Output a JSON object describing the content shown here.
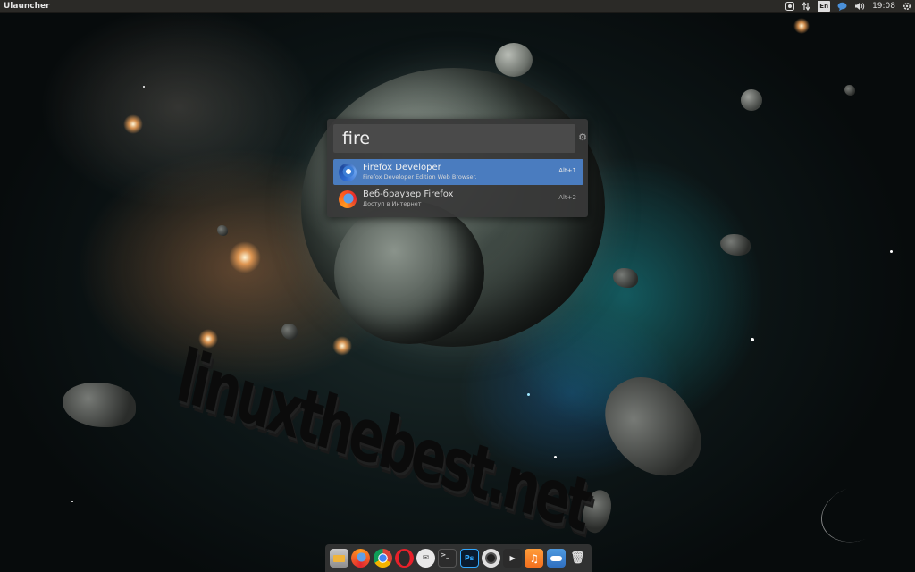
{
  "panel": {
    "title": "Ulauncher",
    "tray": {
      "lang": "En",
      "time": "19:08"
    }
  },
  "launcher": {
    "query": "fire",
    "results": [
      {
        "name": "Firefox Developer",
        "description": "Firefox Developer Edition Web Browser.",
        "shortcut": "Alt+1",
        "selected": true,
        "icon": "firefox-developer-icon"
      },
      {
        "name": "Веб-браузер Firefox",
        "description": "Доступ в Интернет",
        "shortcut": "Alt+2",
        "selected": false,
        "icon": "firefox-icon"
      }
    ]
  },
  "dock": {
    "items": [
      {
        "app": "files",
        "icon": "files-icon"
      },
      {
        "app": "firefox",
        "icon": "firefox-icon"
      },
      {
        "app": "chrome",
        "icon": "chrome-icon"
      },
      {
        "app": "opera",
        "icon": "opera-icon"
      },
      {
        "app": "mail",
        "icon": "mail-icon"
      },
      {
        "app": "terminal",
        "icon": "terminal-icon",
        "glyph": ">_"
      },
      {
        "app": "photoshop",
        "icon": "photoshop-icon",
        "glyph": "Ps"
      },
      {
        "app": "webcam",
        "icon": "webcam-icon"
      },
      {
        "app": "video",
        "icon": "video-editor-icon"
      },
      {
        "app": "music",
        "icon": "music-icon",
        "glyph": "♫"
      },
      {
        "app": "settings-toggle",
        "icon": "toggle-icon"
      },
      {
        "app": "trash",
        "icon": "trash-icon",
        "glyph": "🗑"
      }
    ]
  },
  "wallpaper": {
    "watermark_text": "linuxthebest.net"
  },
  "colors": {
    "panel_bg": "#2b2a27",
    "launcher_bg": "#383838",
    "selection": "#4a7cbf"
  }
}
